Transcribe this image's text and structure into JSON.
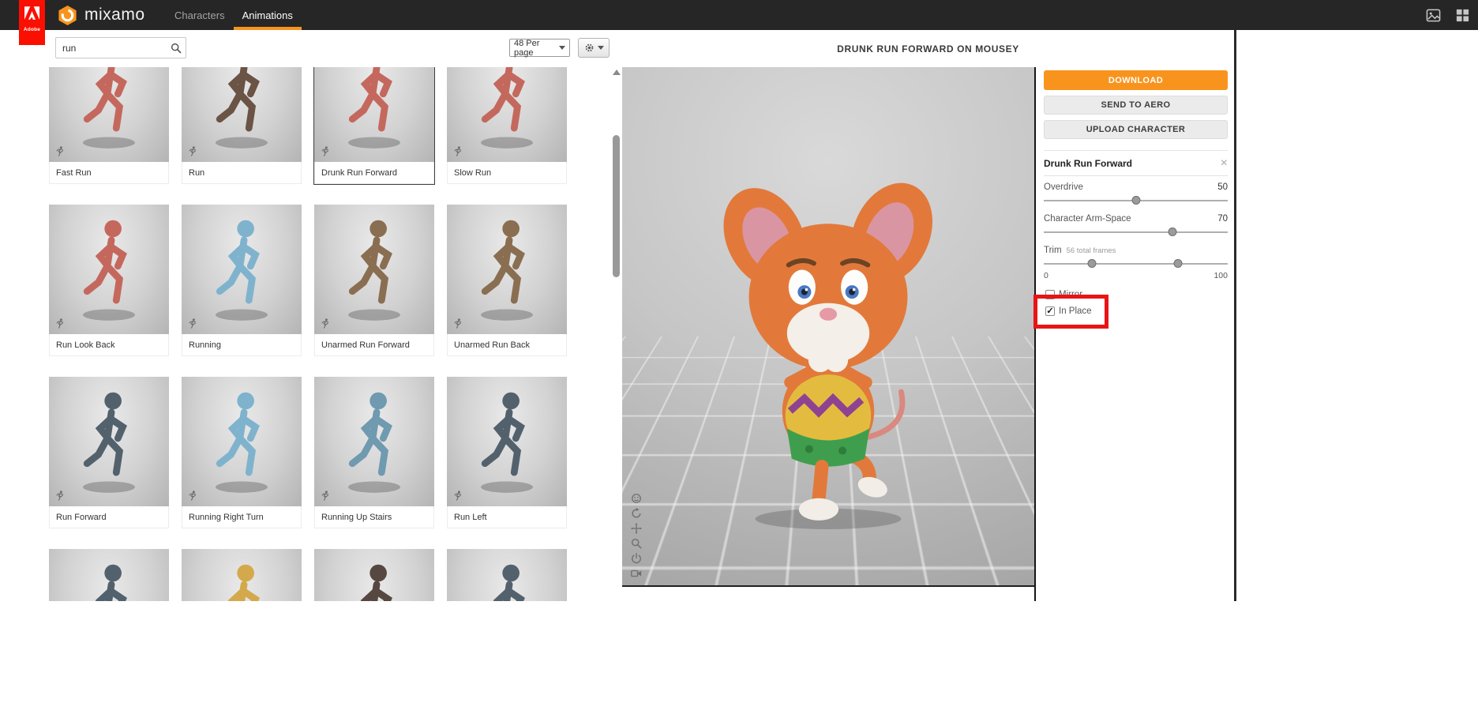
{
  "colors": {
    "accent": "#f8941d",
    "annotation": "#e81416",
    "topbar-bg": "#262626",
    "adobe-red": "#fa0f00"
  },
  "topbar": {
    "adobe_label": "Adobe",
    "brand": "mixamo",
    "nav": [
      {
        "label": "Characters",
        "active": false
      },
      {
        "label": "Animations",
        "active": true
      }
    ]
  },
  "library": {
    "search": {
      "value": "run"
    },
    "per_page_label": "48 Per page",
    "cards": [
      {
        "label": "Fast Run",
        "character_color": "#c4685e",
        "selected": false
      },
      {
        "label": "Run",
        "character_color": "#6b5345",
        "selected": false
      },
      {
        "label": "Drunk Run Forward",
        "character_color": "#c4685e",
        "selected": true
      },
      {
        "label": "Slow Run",
        "character_color": "#c4685e",
        "selected": false
      },
      {
        "label": "Run Look Back",
        "character_color": "#c4685e",
        "selected": false
      },
      {
        "label": "Running",
        "character_color": "#7fb3cd",
        "selected": false
      },
      {
        "label": "Unarmed Run Forward",
        "character_color": "#8a6e51",
        "selected": false
      },
      {
        "label": "Unarmed Run Back",
        "character_color": "#8a6e51",
        "selected": false
      },
      {
        "label": "Run Forward",
        "character_color": "#53616d",
        "selected": false
      },
      {
        "label": "Running Right Turn",
        "character_color": "#7fb3cd",
        "selected": false
      },
      {
        "label": "Running Up Stairs",
        "character_color": "#6f9ab0",
        "selected": false
      },
      {
        "label": "Run Left",
        "character_color": "#53616d",
        "selected": false
      },
      {
        "label": "",
        "character_color": "#53616d",
        "selected": false
      },
      {
        "label": "",
        "character_color": "#d3a94b",
        "selected": false
      },
      {
        "label": "",
        "character_color": "#564840",
        "selected": false
      },
      {
        "label": "",
        "character_color": "#53616d",
        "selected": false
      }
    ]
  },
  "viewport": {
    "title": "DRUNK RUN FORWARD ON MOUSEY"
  },
  "sidebar": {
    "download_label": "DOWNLOAD",
    "send_to_aero_label": "SEND TO AERO",
    "upload_character_label": "UPLOAD CHARACTER",
    "panel": {
      "title": "Drunk Run Forward",
      "close_icon": "×",
      "overdrive": {
        "label": "Overdrive",
        "value": "50",
        "percent": 50
      },
      "arm_space": {
        "label": "Character Arm-Space",
        "value": "70",
        "percent": 70
      },
      "trim": {
        "label": "Trim",
        "note": "56 total frames",
        "min": "0",
        "max": "100",
        "start_percent": 26,
        "end_percent": 73
      },
      "mirror": {
        "label": "Mirror",
        "checked": false
      },
      "in_place": {
        "label": "In Place",
        "checked": true
      }
    }
  }
}
